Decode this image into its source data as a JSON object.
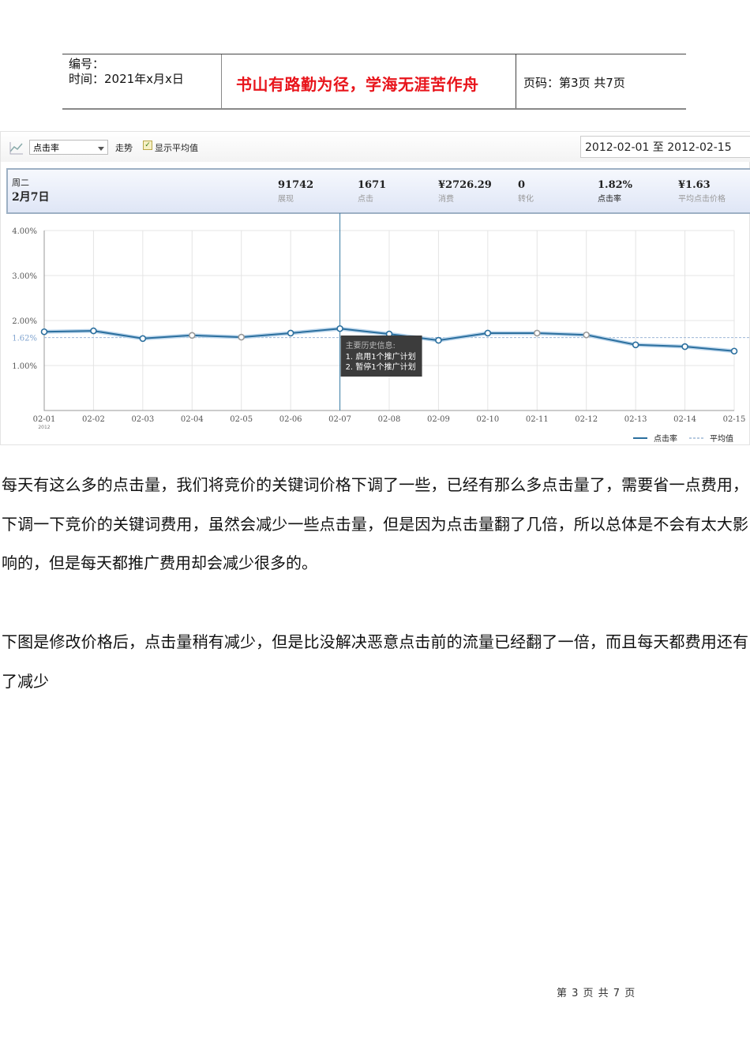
{
  "header": {
    "number_label": "编号：",
    "time_label": "时间：2021年x月x日",
    "motto": "书山有路勤为径，学海无涯苦作舟",
    "page_info": "页码：第3页  共7页"
  },
  "toolbar": {
    "metric_select": "点击率",
    "trend_label": "走势",
    "show_avg_label": "显示平均值",
    "show_avg_checked": true,
    "date_range": "2012-02-01 至 2012-02-15"
  },
  "summary": {
    "weekday": "周二",
    "date": "2月7日",
    "stats": [
      {
        "value": "91742",
        "label": "展现"
      },
      {
        "value": "1671",
        "label": "点击"
      },
      {
        "value": "¥2726.29",
        "label": "消费"
      },
      {
        "value": "0",
        "label": "转化"
      },
      {
        "value": "1.82%",
        "label": "点击率"
      },
      {
        "value": "¥1.63",
        "label": "平均点击价格"
      }
    ]
  },
  "chart_data": {
    "type": "line",
    "x": [
      "02-01",
      "02-02",
      "02-03",
      "02-04",
      "02-05",
      "02-06",
      "02-07",
      "02-08",
      "02-09",
      "02-10",
      "02-11",
      "02-12",
      "02-13",
      "02-14",
      "02-15"
    ],
    "x_sub_label": "2012",
    "series": [
      {
        "name": "点击率",
        "color": "#2b6f9e",
        "values": [
          1.75,
          1.77,
          1.6,
          1.67,
          1.63,
          1.72,
          1.82,
          1.7,
          1.56,
          1.72,
          1.72,
          1.68,
          1.46,
          1.42,
          1.32
        ],
        "grey_markers": [
          "02-04",
          "02-05",
          "02-11",
          "02-12"
        ]
      },
      {
        "name": "平均值",
        "color": "#9db8d6",
        "value": 1.62,
        "style": "dashed"
      }
    ],
    "yticks": [
      "4.00%",
      "3.00%",
      "2.00%",
      "1.00%"
    ],
    "ytick_values": [
      4,
      3,
      2,
      1
    ],
    "avg_label": "1.62%",
    "ylim": [
      0,
      4
    ],
    "grid": true,
    "legend": "bottom-right",
    "highlight_x": "02-07",
    "tooltip": {
      "title": "主要历史信息:",
      "lines": [
        "1. 启用1个推广计划",
        "2. 暂停1个推广计划"
      ]
    }
  },
  "paragraphs": [
    "每天有这么多的点击量，我们将竞价的关键词价格下调了一些，已经有那么多点击量了，需要省一点费用，下调一下竞价的关键词费用，虽然会减少一些点击量，但是因为点击量翻了几倍，所以总体是不会有太大影响的，但是每天都推广费用却会减少很多的。",
    "下图是修改价格后，点击量稍有减少，但是比没解决恶意点击前的流量已经翻了一倍，而且每天都费用还有了减少"
  ],
  "footer": "第 3 页 共 7 页"
}
